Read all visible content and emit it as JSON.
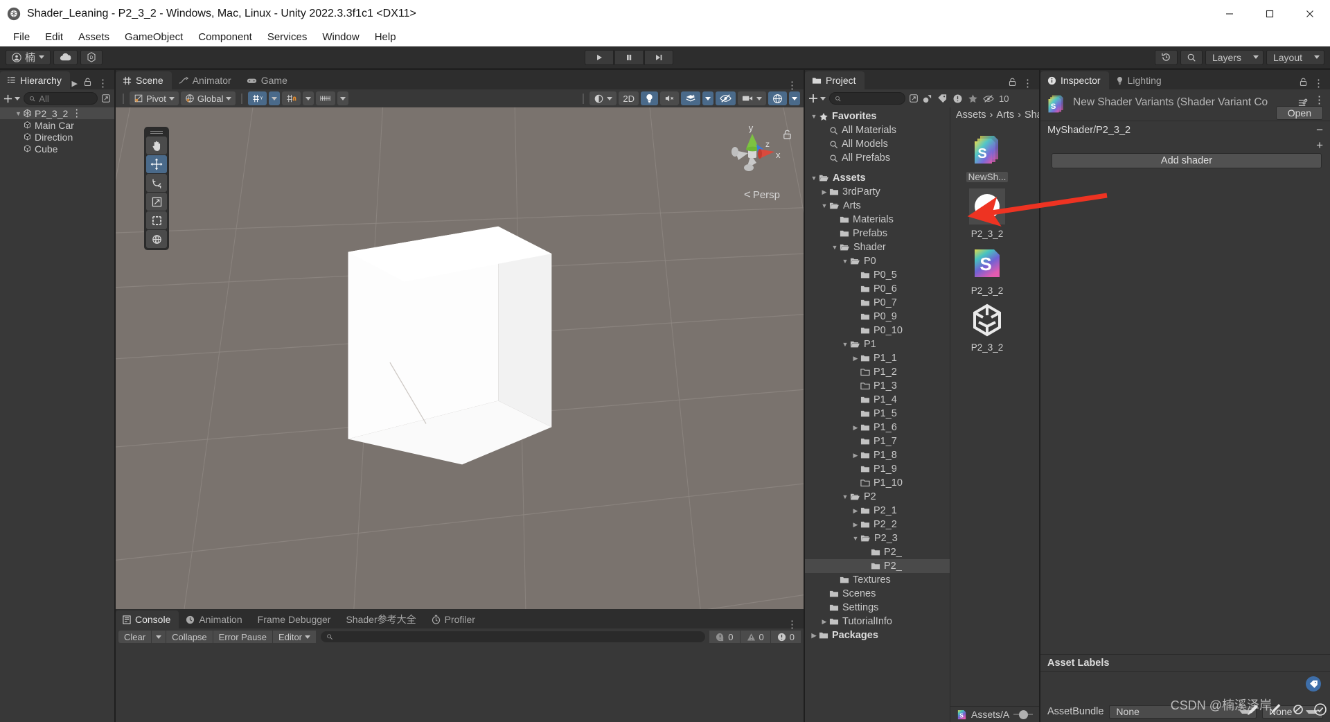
{
  "window": {
    "title": "Shader_Leaning - P2_3_2 - Windows, Mac, Linux - Unity 2022.3.3f1c1 <DX11>",
    "app_icon": "unity-icon",
    "minimize": "–",
    "maximize": "❐",
    "close": "✕"
  },
  "menu": [
    "File",
    "Edit",
    "Assets",
    "GameObject",
    "Component",
    "Services",
    "Window",
    "Help"
  ],
  "toolbar": {
    "account_label": "楠",
    "cloud_icon": "cloud-icon",
    "settings_icon": "unity-services-icon",
    "play": "▶",
    "pause": "⏸",
    "step": "⏭",
    "history_icon": "undo-history-icon",
    "search_icon": "search-icon",
    "layers_label": "Layers",
    "layout_label": "Layout"
  },
  "hierarchy": {
    "tab": "Hierarchy",
    "tab_icon": "hierarchy-icon",
    "search_placeholder": "All",
    "rows": [
      {
        "label": "P2_3_2",
        "indent": 1,
        "tri": "▼",
        "icon": "scene-icon",
        "selected": true,
        "kebab": true
      },
      {
        "label": "Main Car",
        "indent": 2,
        "tri": "",
        "icon": "gameobject-icon",
        "selected": false
      },
      {
        "label": "Direction",
        "indent": 2,
        "tri": "",
        "icon": "gameobject-icon",
        "selected": false
      },
      {
        "label": "Cube",
        "indent": 2,
        "tri": "",
        "icon": "gameobject-icon",
        "selected": false
      }
    ]
  },
  "scene": {
    "tabs": [
      {
        "label": "Scene",
        "icon": "scene-grid-icon",
        "active": true
      },
      {
        "label": "Animator",
        "icon": "animator-icon",
        "active": false
      },
      {
        "label": "Game",
        "icon": "gamepad-icon",
        "active": false
      }
    ],
    "pivot_label": "Pivot",
    "global_label": "Global",
    "two_d_label": "2D",
    "persp_label": "Persp",
    "gizmo_axes": {
      "x": "x",
      "y": "y",
      "z": "z"
    },
    "tools": [
      {
        "name": "hand-tool",
        "glyph": "✋",
        "active": false
      },
      {
        "name": "move-tool",
        "glyph": "move",
        "active": true
      },
      {
        "name": "rotate-tool",
        "glyph": "rotate",
        "active": false
      },
      {
        "name": "scale-tool",
        "glyph": "scale",
        "active": false
      },
      {
        "name": "rect-tool",
        "glyph": "rect",
        "active": false
      },
      {
        "name": "transform-tool",
        "glyph": "transform",
        "active": false
      }
    ]
  },
  "console": {
    "tabs": [
      {
        "label": "Console",
        "icon": "console-icon",
        "active": true
      },
      {
        "label": "Animation",
        "icon": "clock-icon",
        "active": false
      },
      {
        "label": "Frame Debugger",
        "icon": "",
        "active": false
      },
      {
        "label": "Shader参考大全",
        "icon": "",
        "active": false
      },
      {
        "label": "Profiler",
        "icon": "stopwatch-icon",
        "active": false
      }
    ],
    "clear_label": "Clear",
    "collapse_label": "Collapse",
    "error_pause_label": "Error Pause",
    "editor_label": "Editor",
    "search_placeholder": "",
    "counts": {
      "log": "0",
      "warning": "0",
      "error": "0"
    }
  },
  "project": {
    "tab": "Project",
    "tab_icon": "folder-icon",
    "search_placeholder": "",
    "filter_count": "10",
    "breadcrumb": [
      "Assets",
      "Arts",
      "Shader"
    ],
    "status_label": "Assets/A",
    "tree": [
      {
        "label": "Favorites",
        "indent": 0,
        "tri": "▼",
        "icon": "star",
        "bold": true
      },
      {
        "label": "All Materials",
        "indent": 1,
        "tri": "",
        "icon": "search"
      },
      {
        "label": "All Models",
        "indent": 1,
        "tri": "",
        "icon": "search"
      },
      {
        "label": "All Prefabs",
        "indent": 1,
        "tri": "",
        "icon": "search"
      },
      {
        "label": "",
        "indent": 0,
        "tri": "",
        "icon": "spacer"
      },
      {
        "label": "Assets",
        "indent": 0,
        "tri": "▼",
        "icon": "folder-open",
        "bold": true
      },
      {
        "label": "3rdParty",
        "indent": 1,
        "tri": "▶",
        "icon": "folder"
      },
      {
        "label": "Arts",
        "indent": 1,
        "tri": "▼",
        "icon": "folder-open"
      },
      {
        "label": "Materials",
        "indent": 2,
        "tri": "",
        "icon": "folder"
      },
      {
        "label": "Prefabs",
        "indent": 2,
        "tri": "",
        "icon": "folder"
      },
      {
        "label": "Shader",
        "indent": 2,
        "tri": "▼",
        "icon": "folder-open"
      },
      {
        "label": "P0",
        "indent": 3,
        "tri": "▼",
        "icon": "folder-open"
      },
      {
        "label": "P0_5",
        "indent": 4,
        "tri": "",
        "icon": "folder"
      },
      {
        "label": "P0_6",
        "indent": 4,
        "tri": "",
        "icon": "folder"
      },
      {
        "label": "P0_7",
        "indent": 4,
        "tri": "",
        "icon": "folder"
      },
      {
        "label": "P0_9",
        "indent": 4,
        "tri": "",
        "icon": "folder"
      },
      {
        "label": "P0_10",
        "indent": 4,
        "tri": "",
        "icon": "folder"
      },
      {
        "label": "P1",
        "indent": 3,
        "tri": "▼",
        "icon": "folder-open"
      },
      {
        "label": "P1_1",
        "indent": 4,
        "tri": "▶",
        "icon": "folder"
      },
      {
        "label": "P1_2",
        "indent": 4,
        "tri": "",
        "icon": "folder-empty"
      },
      {
        "label": "P1_3",
        "indent": 4,
        "tri": "",
        "icon": "folder-empty"
      },
      {
        "label": "P1_4",
        "indent": 4,
        "tri": "",
        "icon": "folder"
      },
      {
        "label": "P1_5",
        "indent": 4,
        "tri": "",
        "icon": "folder"
      },
      {
        "label": "P1_6",
        "indent": 4,
        "tri": "▶",
        "icon": "folder"
      },
      {
        "label": "P1_7",
        "indent": 4,
        "tri": "",
        "icon": "folder"
      },
      {
        "label": "P1_8",
        "indent": 4,
        "tri": "▶",
        "icon": "folder"
      },
      {
        "label": "P1_9",
        "indent": 4,
        "tri": "",
        "icon": "folder"
      },
      {
        "label": "P1_10",
        "indent": 4,
        "tri": "",
        "icon": "folder-empty"
      },
      {
        "label": "P2",
        "indent": 3,
        "tri": "▼",
        "icon": "folder-open"
      },
      {
        "label": "P2_1",
        "indent": 4,
        "tri": "▶",
        "icon": "folder"
      },
      {
        "label": "P2_2",
        "indent": 4,
        "tri": "▶",
        "icon": "folder"
      },
      {
        "label": "P2_3",
        "indent": 4,
        "tri": "▼",
        "icon": "folder-open"
      },
      {
        "label": "P2_",
        "indent": 5,
        "tri": "",
        "icon": "folder"
      },
      {
        "label": "P2_",
        "indent": 5,
        "tri": "",
        "icon": "folder",
        "selected": true
      },
      {
        "label": "Textures",
        "indent": 2,
        "tri": "",
        "icon": "folder"
      },
      {
        "label": "Scenes",
        "indent": 1,
        "tri": "",
        "icon": "folder"
      },
      {
        "label": "Settings",
        "indent": 1,
        "tri": "",
        "icon": "folder"
      },
      {
        "label": "TutorialInfo",
        "indent": 1,
        "tri": "▶",
        "icon": "folder"
      },
      {
        "label": "Packages",
        "indent": 0,
        "tri": "▶",
        "icon": "folder",
        "bold": true
      }
    ],
    "assets": [
      {
        "name": "NewSh...",
        "icon": "shader-variant-collection-icon",
        "chip": true
      },
      {
        "name": "P2_3_2",
        "icon": "material-sphere-icon",
        "chip": false
      },
      {
        "name": "P2_3_2",
        "icon": "shader-icon",
        "chip": false
      },
      {
        "name": "P2_3_2",
        "icon": "prefab-icon",
        "chip": false
      }
    ]
  },
  "inspector": {
    "tabs": [
      {
        "label": "Inspector",
        "icon": "info-icon",
        "active": true
      },
      {
        "label": "Lighting",
        "icon": "lightbulb-icon",
        "active": false
      }
    ],
    "asset_title": "New Shader Variants (Shader Variant Co",
    "asset_icon": "shader-variant-collection-icon",
    "open_label": "Open",
    "shader_entry": "MyShader/P2_3_2",
    "minus": "−",
    "plus": "+",
    "add_shader_label": "Add shader",
    "asset_labels_title": "Asset Labels",
    "assetbundle_label": "AssetBundle",
    "assetbundle_value": "None",
    "assetbundle_variant": "None"
  },
  "watermark": "CSDN @楠溪泽岸",
  "colors": {
    "accent_blue": "#4a6a8a",
    "panel_bg": "#383838",
    "toolbar_bg": "#2d2d2d",
    "arrow_red": "#ee3322",
    "scene_bg": "#7a736e"
  }
}
